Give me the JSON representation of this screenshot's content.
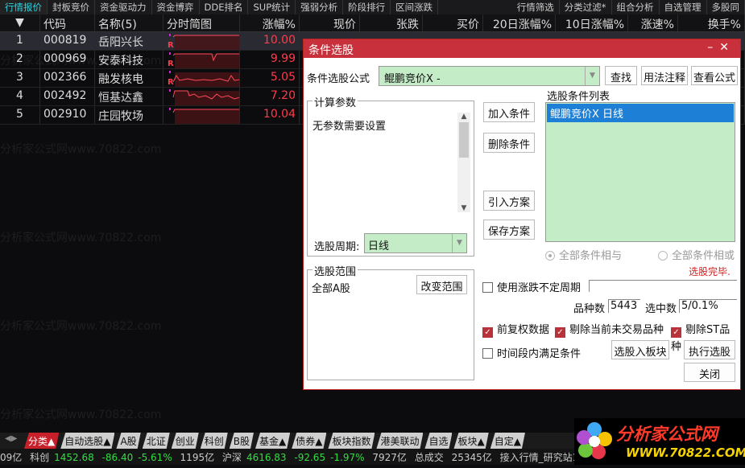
{
  "top_tabs": [
    "行情报价",
    "封板竞价",
    "资金驱动力",
    "资金博弈",
    "DDE排名",
    "SUP统计",
    "强弱分析",
    "阶段排行",
    "区间涨跌"
  ],
  "top_tabs_right": [
    "行情筛选",
    "分类过滤*",
    "组合分析",
    "自选管理",
    "多股同"
  ],
  "columns": [
    "▼",
    "代码",
    "名称(5)",
    "分时简图",
    "涨幅%",
    "现价",
    "张跌",
    "买价",
    "20日涨幅%",
    "10日涨幅%",
    "涨速%",
    "换手%"
  ],
  "rows": [
    {
      "idx": "1",
      "code": "000819",
      "name": "岳阳兴长",
      "chg": "10.00"
    },
    {
      "idx": "2",
      "code": "000969",
      "name": "安泰科技",
      "chg": "9.99"
    },
    {
      "idx": "3",
      "code": "002366",
      "name": "融发核电",
      "chg": "5.05"
    },
    {
      "idx": "4",
      "code": "002492",
      "name": "恒基达鑫",
      "chg": "7.20"
    },
    {
      "idx": "5",
      "code": "002910",
      "name": "庄园牧场",
      "chg": "10.04"
    }
  ],
  "spark_marker": "R",
  "watermark": "分析家公式网www.70822.com",
  "dialog": {
    "title": "条件选股",
    "minimize": "–",
    "close": "✕",
    "formula_label": "条件选股公式",
    "formula_value": "鲲鹏竞价X  -",
    "btn_find": "查找",
    "btn_usage": "用法注释",
    "btn_view": "查看公式",
    "params_legend": "计算参数",
    "params_text": "无参数需要设置",
    "period_label": "选股周期:",
    "period_value": "日线",
    "btn_add": "加入条件",
    "btn_delete": "删除条件",
    "btn_import": "引入方案",
    "btn_save": "保存方案",
    "list_label": "选股条件列表",
    "list_items": [
      "鲲鹏竞价X  日线"
    ],
    "radio_and": "全部条件相与",
    "radio_or": "全部条件相或",
    "status": "选股完毕.",
    "scope_legend": "选股范围",
    "scope_value": "全部A股",
    "btn_scope": "改变范围",
    "use_period": "使用涨跌不定周期",
    "count_label": "品种数",
    "count_value": "5443",
    "selected_label": "选中数",
    "selected_value": "5/0.1%",
    "cb_fq": "前复权数据",
    "cb_notrade": "剔除当前未交易品种",
    "cb_st": "剔除ST品种",
    "cb_timerange": "时间段内满足条件",
    "btn_to_block": "选股入板块",
    "btn_run": "执行选股",
    "btn_close": "关闭"
  },
  "bottom_tabs": [
    "分类▲",
    "自动选股▲",
    "A股",
    "北证",
    "创业",
    "科创",
    "B股",
    "基金▲",
    "债券▲",
    "板块指数",
    "港美联动",
    "自选",
    "板块▲",
    "自定▲"
  ],
  "status_bar": {
    "p0": "09亿",
    "kc_label": "科创",
    "kc_val": "1452.68",
    "kc_chg": "-86.40",
    "kc_pct": "-5.61%",
    "kc_amt": "1195亿",
    "hs_label": "沪深",
    "hs_val": "4616.83",
    "hs_chg": "-92.65",
    "hs_pct": "-1.97%",
    "hs_amt": "7927亿",
    "total_label": "总成交",
    "total_val": "25345亿",
    "conn": "接入行情_研究站1"
  },
  "logo": {
    "text": "分析家公式网",
    "url": "WWW.70822.COM"
  }
}
